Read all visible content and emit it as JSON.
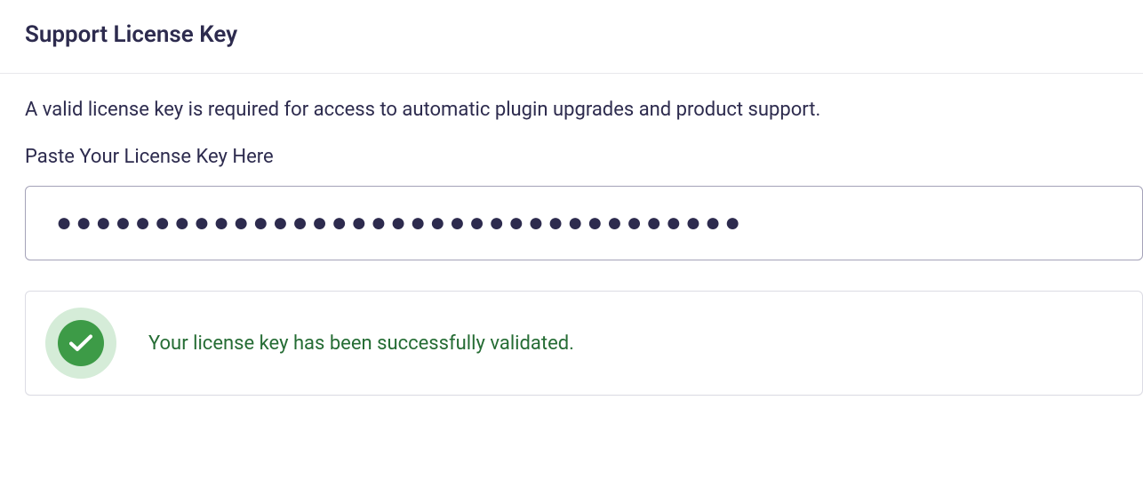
{
  "header": {
    "title": "Support License Key"
  },
  "license": {
    "description": "A valid license key is required for access to automatic plugin upgrades and product support.",
    "field_label": "Paste Your License Key Here",
    "value": "●●●●●●●●●●●●●●●●●●●●●●●●●●●●●●●●●●●",
    "placeholder": ""
  },
  "status": {
    "message": "Your license key has been successfully validated."
  }
}
